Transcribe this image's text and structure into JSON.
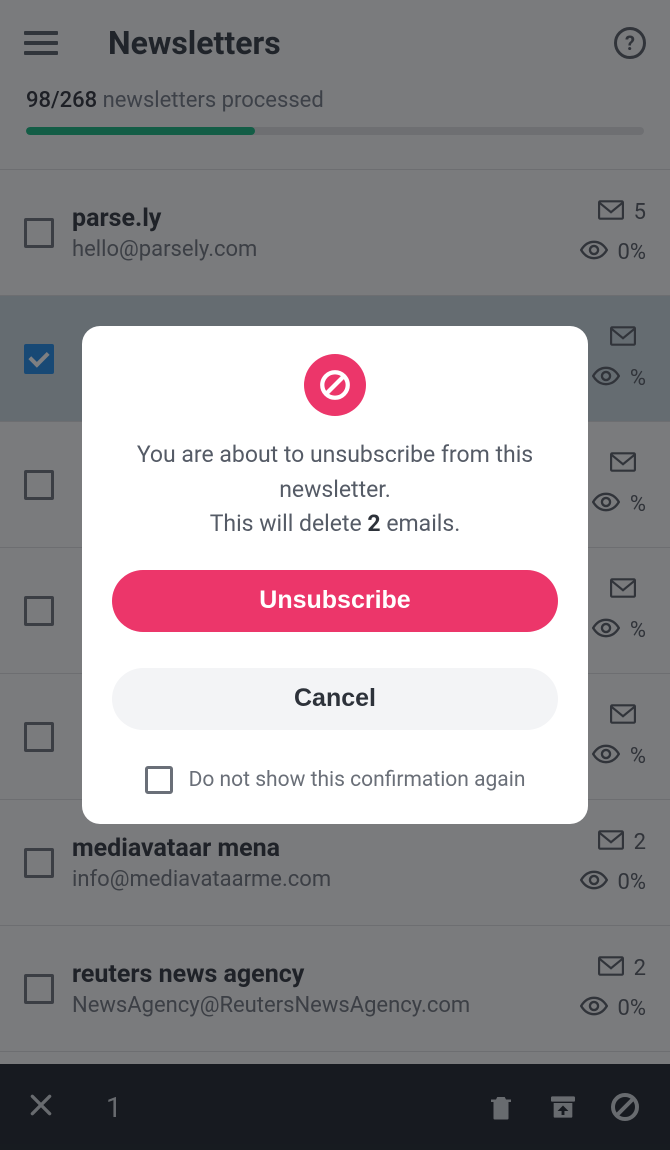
{
  "header": {
    "title": "Newsletters"
  },
  "progress": {
    "processed": "98",
    "total": "268",
    "suffix": "newsletters processed",
    "percent": 37
  },
  "rows": [
    {
      "name": "parse.ly",
      "email": "hello@parsely.com",
      "count": "5",
      "open": "0%",
      "checked": false
    },
    {
      "name": "",
      "email": "",
      "count": "",
      "open": "%",
      "checked": true
    },
    {
      "name": "",
      "email": "",
      "count": "",
      "open": "%",
      "checked": false
    },
    {
      "name": "",
      "email": "",
      "count": "",
      "open": "%",
      "checked": false
    },
    {
      "name": "",
      "email": "",
      "count": "",
      "open": "%",
      "checked": false
    },
    {
      "name": "mediavataar mena",
      "email": "info@mediavataarme.com",
      "count": "2",
      "open": "0%",
      "checked": false
    },
    {
      "name": "reuters news agency",
      "email": "NewsAgency@ReutersNewsAgency.com",
      "count": "2",
      "open": "0%",
      "checked": false
    }
  ],
  "bottomBar": {
    "count": "1"
  },
  "dialog": {
    "line1": "You are about to unsubscribe from this newsletter.",
    "line2a": "This will delete ",
    "count": "2",
    "line2b": " emails.",
    "primary": "Unsubscribe",
    "secondary": "Cancel",
    "dontShow": "Do not show this confirmation again"
  }
}
